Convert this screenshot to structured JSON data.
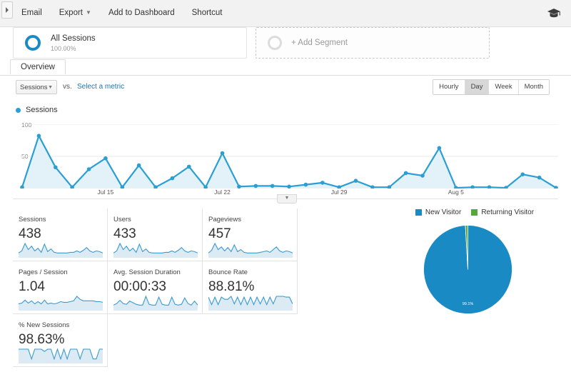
{
  "toolbar": {
    "expander_icon": "chevron-right-icon",
    "items": [
      {
        "label": "Email",
        "has_caret": false
      },
      {
        "label": "Export",
        "has_caret": true
      },
      {
        "label": "Add to Dashboard",
        "has_caret": false
      },
      {
        "label": "Shortcut",
        "has_caret": false
      }
    ],
    "academy_icon": "graduation-cap-icon"
  },
  "segments": {
    "all_sessions": {
      "name": "All Sessions",
      "percent": "100.00%",
      "ring_color": "#1a8ac4"
    },
    "add_segment": {
      "label": "+ Add Segment"
    }
  },
  "tabs": [
    {
      "label": "Overview",
      "active": true
    }
  ],
  "metric_selector": {
    "selected_metric": "Sessions",
    "caret_icon": "chevron-down-icon",
    "vs_label": "vs.",
    "select_metric_link": "Select a metric",
    "link_color": "#1a73b7"
  },
  "granularity": {
    "options": [
      "Hourly",
      "Day",
      "Week",
      "Month"
    ],
    "selected": "Day"
  },
  "series_legend": {
    "label": "Sessions",
    "color": "#2b9fd4"
  },
  "chart_data": {
    "type": "line",
    "title": "Sessions",
    "xlabel": "",
    "ylabel": "",
    "ylim": [
      0,
      100
    ],
    "yticks": [
      50,
      100
    ],
    "ytick_labels": [
      "50",
      "100"
    ],
    "grid": true,
    "legend_position": "top-left",
    "tick_labels": [
      "Jul 15",
      "Jul 22",
      "Jul 29",
      "Aug 5"
    ],
    "tick_indices": [
      5,
      12,
      19,
      26
    ],
    "area_fill": "#e3f1f8",
    "line_color": "#2b9fd4",
    "series": [
      {
        "name": "Sessions",
        "values": [
          2,
          82,
          33,
          2,
          30,
          47,
          2,
          36,
          2,
          16,
          34,
          2,
          55,
          3,
          4,
          4,
          3,
          6,
          9,
          2,
          12,
          2,
          2,
          24,
          20,
          63,
          1,
          2,
          2,
          1,
          22,
          17,
          1
        ]
      }
    ]
  },
  "collapse_handle_icon": "chevron-down-icon",
  "metric_cards": [
    {
      "title": "Sessions",
      "value": "438",
      "spark": [
        6,
        9,
        20,
        11,
        16,
        9,
        13,
        7,
        19,
        8,
        12,
        7,
        6,
        6,
        6,
        6,
        7,
        7,
        9,
        7,
        10,
        14,
        9,
        7,
        9,
        8,
        6
      ]
    },
    {
      "title": "Users",
      "value": "433",
      "spark": [
        6,
        9,
        20,
        11,
        16,
        9,
        13,
        7,
        19,
        8,
        12,
        7,
        6,
        6,
        6,
        6,
        7,
        7,
        9,
        7,
        10,
        14,
        9,
        7,
        9,
        8,
        6
      ]
    },
    {
      "title": "Pageviews",
      "value": "457",
      "spark": [
        6,
        10,
        20,
        11,
        15,
        9,
        14,
        8,
        18,
        8,
        11,
        7,
        6,
        6,
        6,
        6,
        7,
        8,
        9,
        7,
        11,
        15,
        9,
        7,
        9,
        8,
        6
      ]
    },
    {
      "title": "Pages / Session",
      "value": "1.04",
      "spark": [
        8,
        9,
        13,
        9,
        12,
        8,
        11,
        8,
        13,
        8,
        9,
        8,
        9,
        11,
        10,
        10,
        11,
        12,
        18,
        14,
        12,
        12,
        12,
        12,
        11,
        11,
        10
      ]
    },
    {
      "title": "Avg. Session Duration",
      "value": "00:00:33",
      "spark": [
        6,
        8,
        12,
        8,
        7,
        11,
        9,
        7,
        6,
        6,
        17,
        7,
        6,
        6,
        16,
        7,
        6,
        6,
        16,
        7,
        6,
        7,
        15,
        8,
        6,
        11,
        6
      ]
    },
    {
      "title": "Bounce Rate",
      "value": "88.81%",
      "spark": [
        17,
        7,
        17,
        7,
        17,
        14,
        14,
        18,
        8,
        17,
        7,
        17,
        7,
        17,
        7,
        17,
        8,
        17,
        7,
        17,
        8,
        18,
        18,
        18,
        17,
        17,
        8
      ]
    },
    {
      "title": "% New Sessions",
      "value": "98.63%",
      "spark": [
        18,
        18,
        18,
        18,
        5,
        18,
        18,
        18,
        15,
        18,
        18,
        5,
        18,
        5,
        18,
        5,
        18,
        18,
        18,
        5,
        18,
        18,
        18,
        5,
        5,
        18,
        18
      ]
    }
  ],
  "pie": {
    "legend": [
      {
        "label": "New Visitor",
        "color": "#1a8ac4"
      },
      {
        "label": "Returning Visitor",
        "color": "#56a83c"
      }
    ],
    "chart_data": {
      "type": "pie",
      "title": "",
      "labels": [
        "New Visitor",
        "Returning Visitor"
      ],
      "values": [
        99.1,
        0.9
      ],
      "colors": [
        "#1a8ac4",
        "#56a83c"
      ],
      "data_labels": [
        "99.1%",
        ""
      ],
      "legend_position": "top"
    }
  }
}
